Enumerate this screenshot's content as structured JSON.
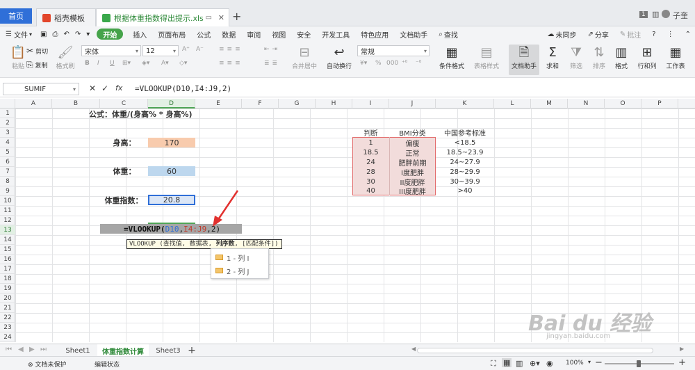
{
  "tabs": {
    "home": "首页",
    "template": "稻壳模板",
    "file": "根据体重指数得出提示.xls"
  },
  "window": {
    "badge": "1",
    "user": "子奎"
  },
  "menu": {
    "file": "文件",
    "start": "开始",
    "items": [
      "插入",
      "页面布局",
      "公式",
      "数据",
      "审阅",
      "视图",
      "安全",
      "开发工具",
      "特色应用",
      "文档助手"
    ],
    "search": "查找",
    "sync": "未同步",
    "share": "分享",
    "comment": "批注",
    "help": "?"
  },
  "toolbar": {
    "paste": "粘贴",
    "cut": "剪切",
    "copy": "复制",
    "format_painter": "格式刷",
    "font_name": "宋体",
    "font_size": "12",
    "merge": "合并居中",
    "wrap": "自动换行",
    "number_format": "常规",
    "cond_format": "条件格式",
    "table_style": "表格样式",
    "doc_assistant": "文档助手",
    "sum": "求和",
    "filter": "筛选",
    "sort": "排序",
    "format": "格式",
    "row_col": "行和列",
    "worksheet": "工作表"
  },
  "formula_bar": {
    "name_box": "SUMIF",
    "fx": "fx",
    "formula": "=VLOOKUP(D10,I4:J9,2)"
  },
  "columns": [
    "A",
    "B",
    "C",
    "D",
    "E",
    "F",
    "G",
    "H",
    "I",
    "J",
    "K",
    "L",
    "M",
    "N",
    "O",
    "P"
  ],
  "rows": [
    "1",
    "2",
    "3",
    "4",
    "5",
    "6",
    "7",
    "8",
    "9",
    "10",
    "11",
    "12",
    "13",
    "14",
    "15",
    "16",
    "17",
    "18",
    "19",
    "20",
    "21",
    "22",
    "23",
    "24"
  ],
  "cells": {
    "formula_title": "公式：体重/(身高% * 身高%)",
    "height_label": "身高：",
    "height_value": "170",
    "weight_label": "体重：",
    "weight_value": "60",
    "bmi_label": "体重指数：",
    "bmi_value": "20.8",
    "edit_formula_fn": "=VLOOKUP(",
    "edit_formula_ref1": "D10",
    "edit_formula_sep": ",",
    "edit_formula_ref2": "I4:J9",
    "edit_formula_tail": ",2)"
  },
  "lookup_table": {
    "headers": [
      "判断",
      "BMI分类",
      "中国参考标准"
    ],
    "rows": [
      [
        "1",
        "偏瘦",
        "<18.5"
      ],
      [
        "18.5",
        "正常",
        "18.5~23.9"
      ],
      [
        "24",
        "肥胖前期",
        "24~27.9"
      ],
      [
        "28",
        "I度肥胖",
        "28~29.9"
      ],
      [
        "30",
        "II度肥胖",
        "30~39.9"
      ],
      [
        "40",
        "III度肥胖",
        ">40"
      ]
    ]
  },
  "tooltip": {
    "pre": "VLOOKUP (查找值, 数据表, ",
    "bold": "列序数",
    "post": ", [匹配条件])"
  },
  "autocomplete": [
    "1 - 列 I",
    "2 - 列 J"
  ],
  "sheets": [
    "Sheet1",
    "体重指数计算",
    "Sheet3"
  ],
  "status": {
    "protect": "文档未保护",
    "mode": "编辑状态",
    "zoom": "100%"
  },
  "watermark": {
    "brand": "Bai du 经验",
    "url": "jingyan.baidu.com"
  },
  "colors": {
    "accent_green": "#45a34a",
    "home_tab": "#2f6fd8",
    "height_fill": "#f8cbad",
    "weight_fill": "#bdd7ee",
    "table_fill": "#f2dcdb",
    "table_border": "#e26b6b",
    "edit_row_fill": "#a6a6a6",
    "arrow_red": "#e2312f"
  }
}
